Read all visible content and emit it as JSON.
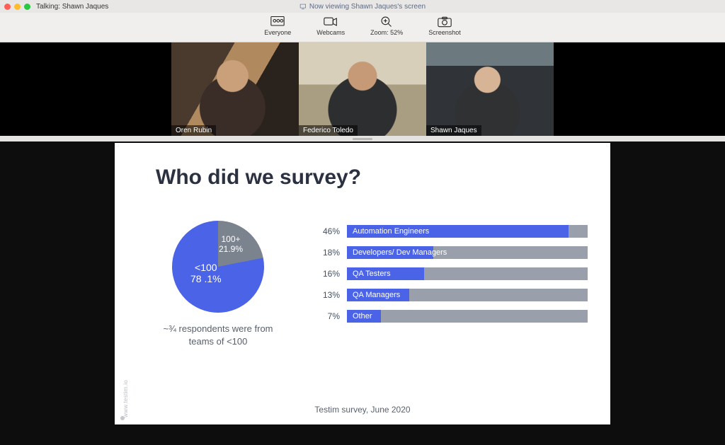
{
  "titlebar": {
    "talking_prefix": "Talking:",
    "talking_name": "Shawn Jaques",
    "viewing_text": "Now viewing Shawn Jaques's screen"
  },
  "toolbar": {
    "everyone": "Everyone",
    "webcams": "Webcams",
    "zoom_label": "Zoom: 52%",
    "screenshot": "Screenshot"
  },
  "participants": [
    {
      "name": "Oren Rubin",
      "active": false
    },
    {
      "name": "Federico Toledo",
      "active": false
    },
    {
      "name": "Shawn Jaques",
      "active": true
    }
  ],
  "slide": {
    "title": "Who did we survey?",
    "pie_caption": "~¾ respondents were from teams of <100",
    "footer": "Testim survey, June 2020",
    "credit": "www.testim.io"
  },
  "chart_data": [
    {
      "type": "pie",
      "title": "Team size",
      "slices": [
        {
          "label": "100+",
          "value": 21.9,
          "display": "21.9%",
          "color": "#7b838e"
        },
        {
          "label": "<100",
          "value": 78.1,
          "display": "78 .1%",
          "color": "#4a63e7"
        }
      ]
    },
    {
      "type": "bar",
      "title": "Respondent role",
      "categories": [
        "Automation Engineers",
        "Developers/ Dev Managers",
        "QA Testers",
        "QA Managers",
        "Other"
      ],
      "values": [
        46,
        18,
        16,
        13,
        7
      ],
      "value_suffix": "%",
      "xlim": [
        0,
        50
      ]
    }
  ]
}
